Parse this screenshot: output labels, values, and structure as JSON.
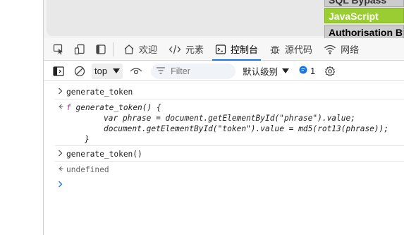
{
  "page": {
    "menu_partial": "SQL Bypass",
    "menu_active": "JavaScript",
    "menu_next": "Authorisation Bypass"
  },
  "tabs": [
    {
      "label": "欢迎",
      "icon": "home-icon"
    },
    {
      "label": "元素",
      "icon": "code-tags-icon"
    },
    {
      "label": "控制台",
      "icon": "console-icon"
    },
    {
      "label": "源代码",
      "icon": "bug-icon"
    },
    {
      "label": "网络",
      "icon": "wifi-icon"
    }
  ],
  "toolbar": {
    "context": "top",
    "filter_placeholder": "Filter",
    "level": "默认级别",
    "issues_count": "1"
  },
  "console": {
    "cmd1": "generate_token",
    "fn_f": "f",
    "fn_sig": "generate_token() {",
    "fn_line1": "var phrase = document.getElementById(\"phrase\").value;",
    "fn_line2": "document.getElementById(\"token\").value = md5(rot13(phrase));",
    "fn_close": "}",
    "cmd2": "generate_token()",
    "result2": "undefined"
  },
  "colors": {
    "accent": "#1a73e8",
    "menu_active_bg": "#9acd32"
  }
}
